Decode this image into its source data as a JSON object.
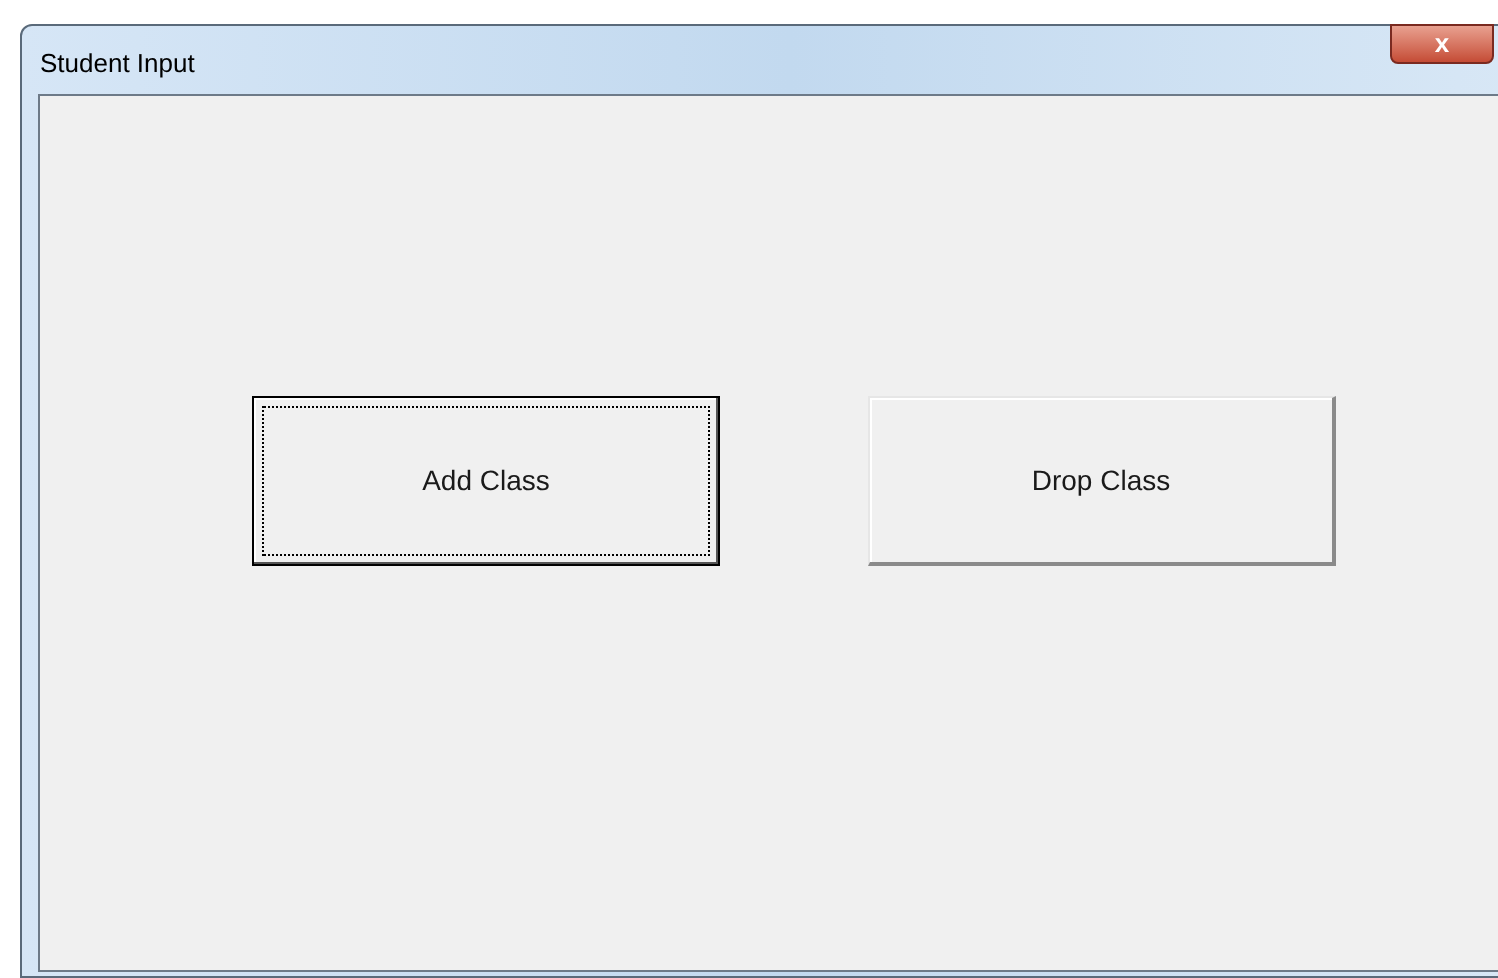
{
  "window": {
    "title": "Student Input",
    "close_label": "x"
  },
  "buttons": [
    {
      "label": "Add Class",
      "focused": true
    },
    {
      "label": "Drop Class",
      "focused": false
    }
  ]
}
